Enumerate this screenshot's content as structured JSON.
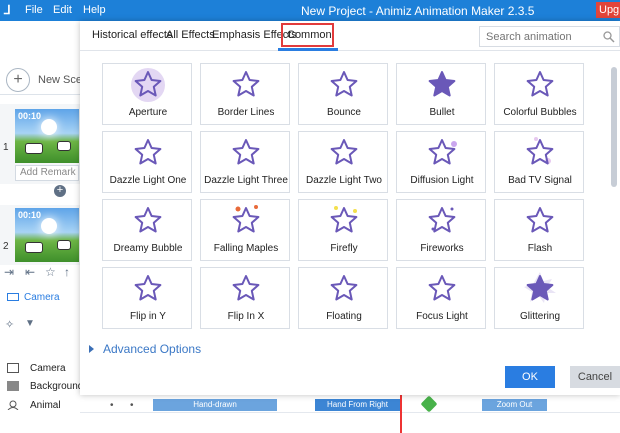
{
  "titlebar": {
    "logo": "⅃",
    "menu": [
      "File",
      "Edit",
      "Help"
    ],
    "title": "New Project - Animiz Animation Maker 2.3.5",
    "upgrade": "Upg"
  },
  "left_panel": {
    "new_scene": "New Scene",
    "scenes": [
      {
        "number": "1",
        "time": "00:10",
        "remark_placeholder": "Add Remark"
      },
      {
        "number": "2",
        "time": "00:10"
      }
    ],
    "camera_label": "Camera",
    "timeline_labels": [
      "Camera",
      "Background",
      "Animal"
    ]
  },
  "dialog": {
    "tabs": [
      "Historical effects",
      "All Effects",
      "Emphasis Effects",
      "Common"
    ],
    "active_tab": "Common",
    "search_placeholder": "Search animation",
    "effects": [
      [
        "Aperture",
        "Border Lines",
        "Bounce",
        "Bullet",
        "Colorful Bubbles"
      ],
      [
        "Dazzle Light One",
        "Dazzle Light Three",
        "Dazzle Light Two",
        "Diffusion Light",
        "Bad TV Signal"
      ],
      [
        "Dreamy Bubble",
        "Falling Maples",
        "Firefly",
        "Fireworks",
        "Flash"
      ],
      [
        "Flip in Y",
        "Flip In X",
        "Floating",
        "Focus Light",
        "Glittering"
      ]
    ],
    "advanced_options": "Advanced Options",
    "ok": "OK",
    "cancel": "Cancel"
  },
  "timeline": {
    "bars": [
      "Hand-drawn",
      "Hand From Right",
      "Zoom Out"
    ]
  },
  "colors": {
    "accent": "#2a7de1",
    "star": "#6a58b8",
    "highlight": "#e23b3b"
  }
}
